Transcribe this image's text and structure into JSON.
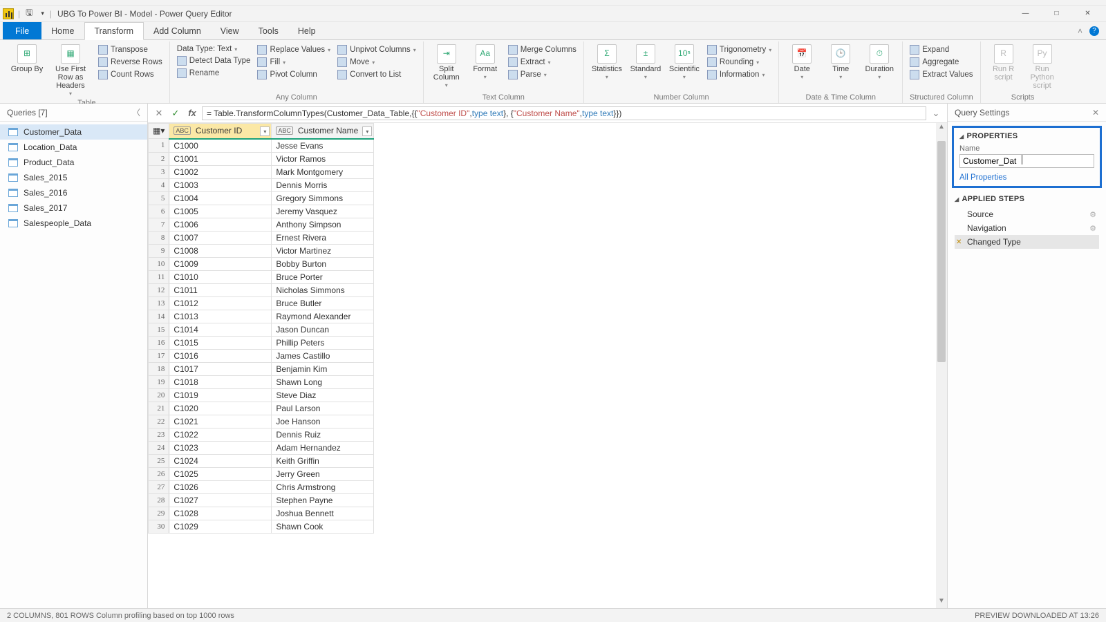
{
  "window": {
    "title": "UBG To Power BI - Model - Power Query Editor",
    "save_icon": "save-icon",
    "qat_dd": "▾"
  },
  "win_btns": {
    "min": "—",
    "max": "□",
    "close": "✕"
  },
  "tabs": {
    "file": "File",
    "home": "Home",
    "transform": "Transform",
    "addcol": "Add Column",
    "view": "View",
    "tools": "Tools",
    "help": "Help",
    "collapse": "˄"
  },
  "ribbon": {
    "groups": {
      "table": "Table",
      "anycol": "Any Column",
      "textcol": "Text Column",
      "numcol": "Number Column",
      "datetime": "Date & Time Column",
      "structcol": "Structured Column",
      "scripts": "Scripts"
    },
    "table": {
      "groupby": "Group By",
      "firstrow": "Use First Row as Headers",
      "transpose": "Transpose",
      "reverse": "Reverse Rows",
      "count": "Count Rows"
    },
    "anycol": {
      "datatype": "Data Type: Text",
      "detect": "Detect Data Type",
      "rename": "Rename",
      "replace": "Replace Values",
      "fill": "Fill",
      "pivot": "Pivot Column",
      "unpivot": "Unpivot Columns",
      "move": "Move",
      "convert": "Convert to List"
    },
    "textcol": {
      "split": "Split Column",
      "format": "Format",
      "merge": "Merge Columns",
      "extract": "Extract",
      "parse": "Parse"
    },
    "numcol": {
      "stats": "Statistics",
      "standard": "Standard",
      "scientific": "Scientific",
      "trig": "Trigonometry",
      "round": "Rounding",
      "info": "Information"
    },
    "datetime": {
      "date": "Date",
      "time": "Time",
      "duration": "Duration"
    },
    "structcol": {
      "expand": "Expand",
      "aggregate": "Aggregate",
      "extractv": "Extract Values"
    },
    "scripts": {
      "r": "Run R script",
      "py": "Run Python script"
    }
  },
  "queries": {
    "header": "Queries [7]",
    "items": [
      {
        "label": "Customer_Data",
        "selected": true
      },
      {
        "label": "Location_Data"
      },
      {
        "label": "Product_Data"
      },
      {
        "label": "Sales_2015"
      },
      {
        "label": "Sales_2016"
      },
      {
        "label": "Sales_2017"
      },
      {
        "label": "Salespeople_Data"
      }
    ]
  },
  "formula": {
    "prefix": "= Table.TransformColumnTypes(Customer_Data_Table,{{",
    "s1": "\"Customer ID\"",
    "mid1": ", ",
    "t1": "type text",
    "mid2": "}, {",
    "s2": "\"Customer Name\"",
    "mid3": ", ",
    "t2": "type text",
    "suffix": "}})"
  },
  "grid": {
    "cols": [
      {
        "name": "Customer ID",
        "type": "A<sup>B</sup>C"
      },
      {
        "name": "Customer Name",
        "type": "A<sup>B</sup>C"
      }
    ],
    "rows": [
      [
        "C1000",
        "Jesse Evans"
      ],
      [
        "C1001",
        "Victor Ramos"
      ],
      [
        "C1002",
        "Mark Montgomery"
      ],
      [
        "C1003",
        "Dennis Morris"
      ],
      [
        "C1004",
        "Gregory Simmons"
      ],
      [
        "C1005",
        "Jeremy Vasquez"
      ],
      [
        "C1006",
        "Anthony Simpson"
      ],
      [
        "C1007",
        "Ernest Rivera"
      ],
      [
        "C1008",
        "Victor Martinez"
      ],
      [
        "C1009",
        "Bobby Burton"
      ],
      [
        "C1010",
        "Bruce Porter"
      ],
      [
        "C1011",
        "Nicholas Simmons"
      ],
      [
        "C1012",
        "Bruce Butler"
      ],
      [
        "C1013",
        "Raymond Alexander"
      ],
      [
        "C1014",
        "Jason Duncan"
      ],
      [
        "C1015",
        "Phillip Peters"
      ],
      [
        "C1016",
        "James Castillo"
      ],
      [
        "C1017",
        "Benjamin Kim"
      ],
      [
        "C1018",
        "Shawn Long"
      ],
      [
        "C1019",
        "Steve Diaz"
      ],
      [
        "C1020",
        "Paul Larson"
      ],
      [
        "C1021",
        "Joe Hanson"
      ],
      [
        "C1022",
        "Dennis Ruiz"
      ],
      [
        "C1023",
        "Adam Hernandez"
      ],
      [
        "C1024",
        "Keith Griffin"
      ],
      [
        "C1025",
        "Jerry Green"
      ],
      [
        "C1026",
        "Chris Armstrong"
      ],
      [
        "C1027",
        "Stephen Payne"
      ],
      [
        "C1028",
        "Joshua Bennett"
      ],
      [
        "C1029",
        "Shawn Cook"
      ]
    ]
  },
  "settings": {
    "header": "Query Settings",
    "props_title": "PROPERTIES",
    "name_label": "Name",
    "name_value": "Customer_Dat",
    "all_props": "All Properties",
    "steps_title": "APPLIED STEPS",
    "steps": [
      {
        "label": "Source",
        "gear": true
      },
      {
        "label": "Navigation",
        "gear": true
      },
      {
        "label": "Changed Type",
        "selected": true
      }
    ]
  },
  "status": {
    "left": "2 COLUMNS, 801 ROWS    Column profiling based on top 1000 rows",
    "right": "PREVIEW DOWNLOADED AT 13:26"
  }
}
